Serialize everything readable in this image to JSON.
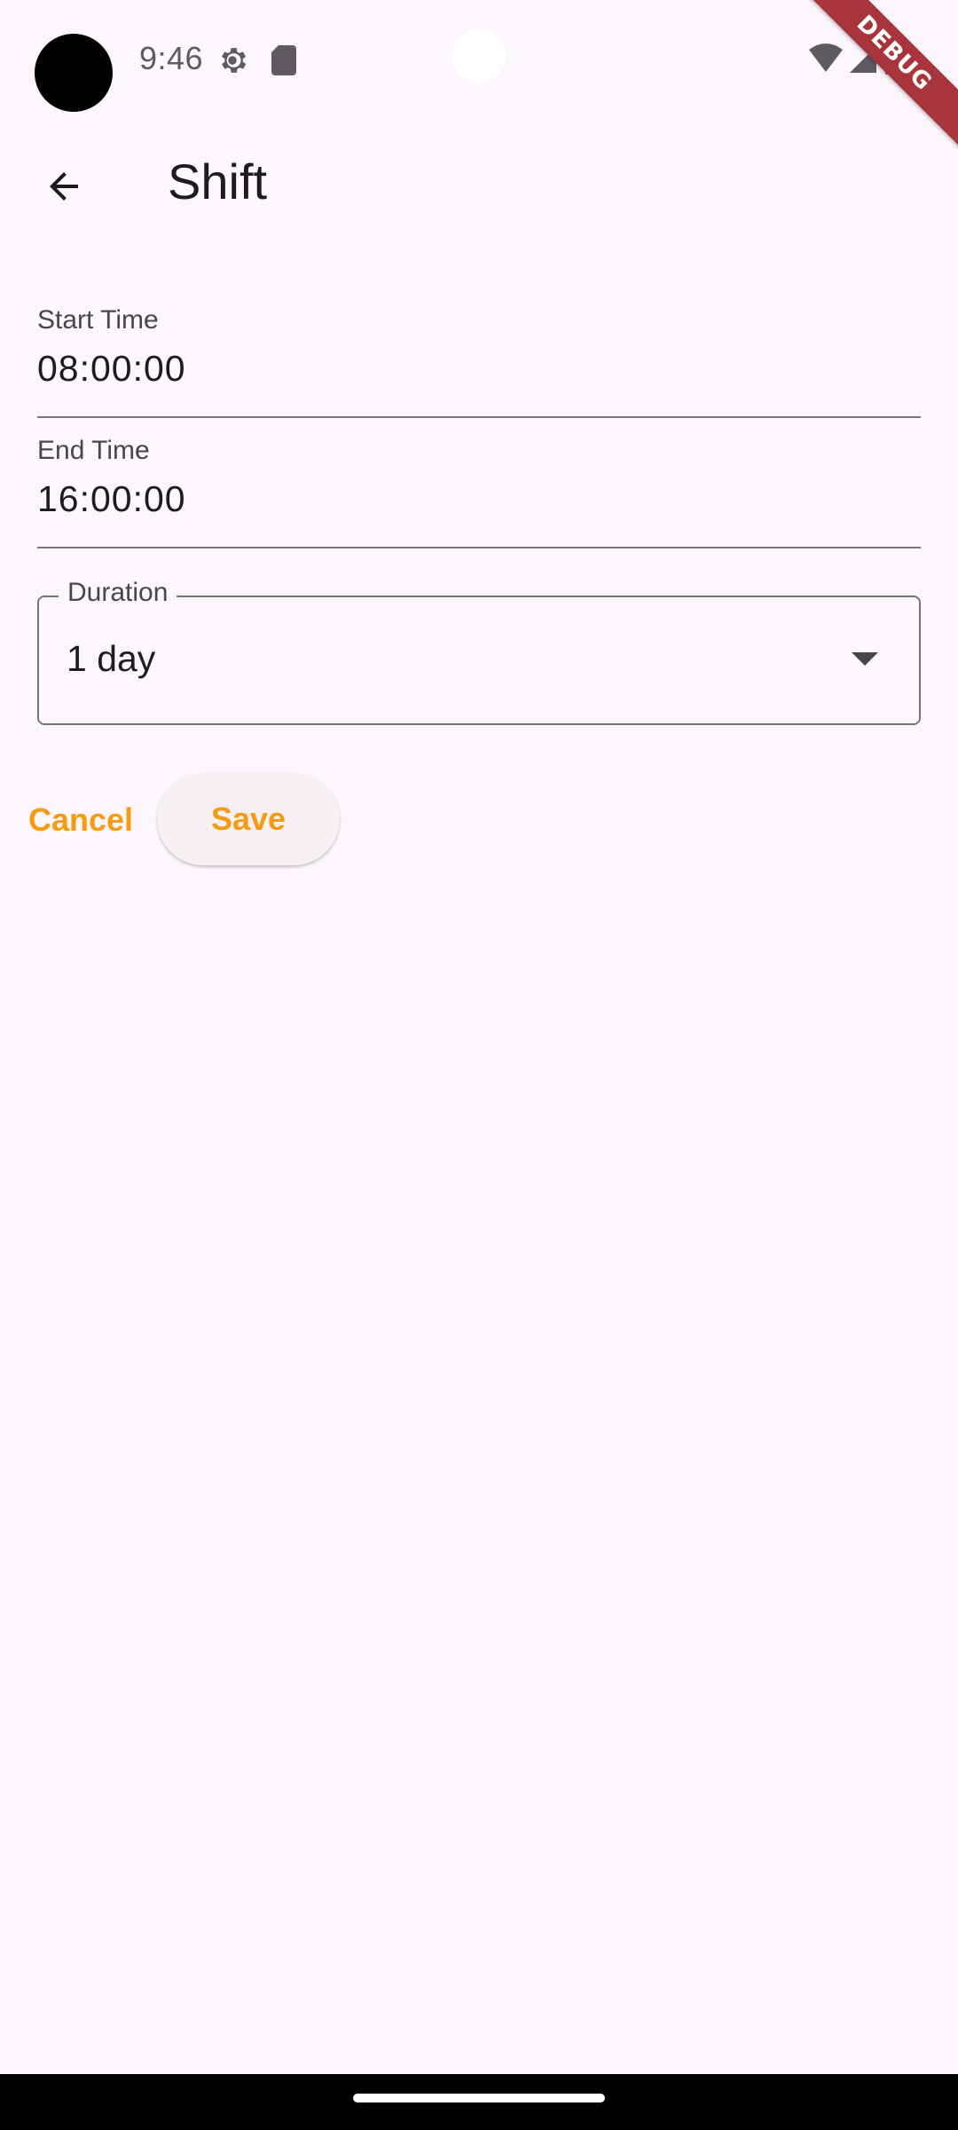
{
  "status_bar": {
    "time": "9:46",
    "left_icons": [
      "gear-icon",
      "sd-card-icon"
    ],
    "right_icons": [
      "wifi-icon",
      "signal-icon",
      "battery-icon"
    ]
  },
  "debug_banner": {
    "label": "DEBUG",
    "color": "#a8343c"
  },
  "app_bar": {
    "back_icon": "arrow-back-icon",
    "title": "Shift"
  },
  "form": {
    "start_time": {
      "label": "Start Time",
      "value": "08:00:00"
    },
    "end_time": {
      "label": "End Time",
      "value": "16:00:00"
    },
    "duration": {
      "label": "Duration",
      "selected": "1 day"
    }
  },
  "actions": {
    "cancel_label": "Cancel",
    "save_label": "Save",
    "accent_color": "#f39c12"
  },
  "colors": {
    "background": "#fdf6fc",
    "text_primary": "#1d1b20",
    "text_secondary": "#49454f",
    "outline": "#79747e"
  }
}
